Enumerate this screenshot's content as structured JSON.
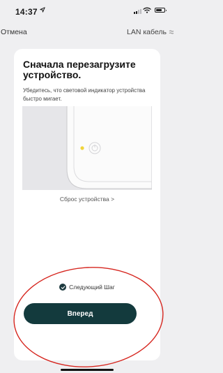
{
  "status_bar": {
    "time": "14:37",
    "icons": [
      "location-arrow-icon",
      "cellular-signal-icon",
      "wifi-icon",
      "battery-icon"
    ]
  },
  "nav": {
    "cancel_label": "Отмена",
    "mode_label": "LAN кабель",
    "mode_icon": "ethernet-icon"
  },
  "card": {
    "title": "Сначала перезагрузите устройство.",
    "subtitle": "Убедитесь, что световой индикатор устройства быстро мигает.",
    "reset_link": "Сброс устройства >",
    "next_step_label": "Следующий Шаг",
    "forward_button": "Вперед"
  },
  "colors": {
    "button_bg": "#133a3d",
    "annotation_ellipse": "#d6261f",
    "indicator_led": "#f0d43a"
  }
}
